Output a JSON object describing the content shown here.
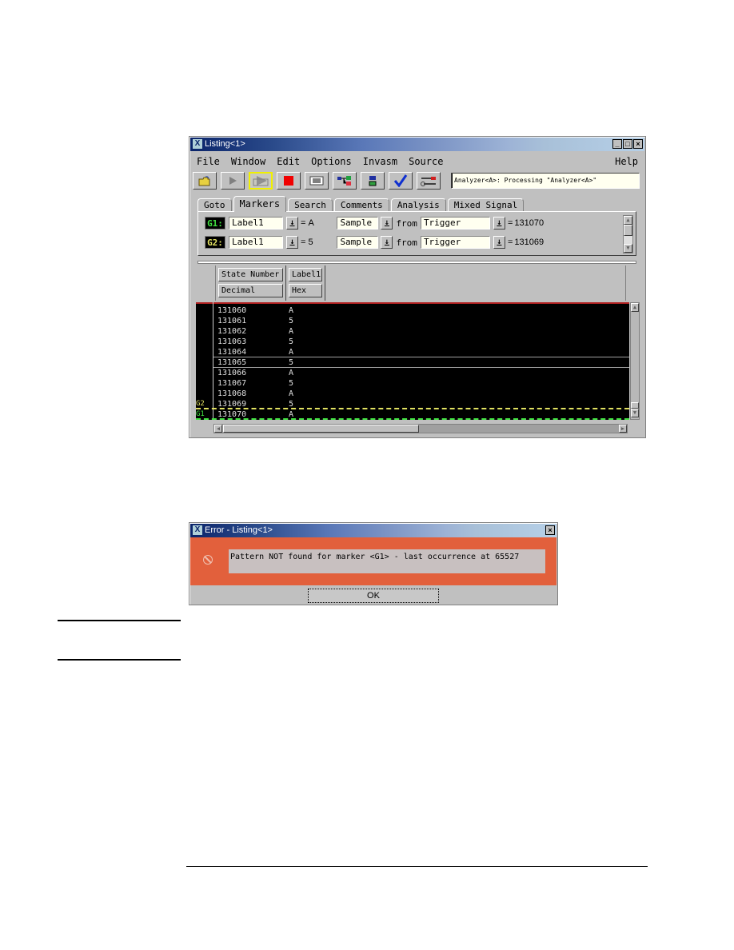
{
  "listing_window": {
    "title": "Listing<1>",
    "window_buttons": {
      "minimize": "_",
      "maximize": "□",
      "close": "×"
    },
    "menu": [
      "File",
      "Window",
      "Edit",
      "Options",
      "Invasm",
      "Source"
    ],
    "help_menu": "Help",
    "toolbar": [
      {
        "icon": "open-folder-icon",
        "active": false
      },
      {
        "icon": "run-icon",
        "active": false
      },
      {
        "icon": "run-repetitive-icon",
        "active": true
      },
      {
        "icon": "stop-icon",
        "active": false
      },
      {
        "icon": "listing-icon",
        "active": false
      },
      {
        "icon": "overview-icon",
        "active": false
      },
      {
        "icon": "module-icon",
        "active": false
      },
      {
        "icon": "checkmark-icon",
        "active": false
      },
      {
        "icon": "tools-icon",
        "active": false
      }
    ],
    "status_text": "Analyzer<A>: Processing \"Analyzer<A>\"",
    "tabs": [
      "Goto",
      "Markers",
      "Search",
      "Comments",
      "Analysis",
      "Mixed Signal"
    ],
    "active_tab": "Markers",
    "markers": [
      {
        "name": "G1:",
        "color": "#40e040",
        "label": "Label1",
        "value": "A",
        "mode": "Sample",
        "from_text": "from",
        "reference": "Trigger",
        "result": "131070"
      },
      {
        "name": "G2:",
        "color": "#e0e060",
        "label": "Label1",
        "value": "5",
        "mode": "Sample",
        "from_text": "from",
        "reference": "Trigger",
        "result": "131069"
      }
    ],
    "columns": [
      {
        "header": "State Number",
        "base": "Decimal"
      },
      {
        "header": "Label1",
        "base": "Hex"
      }
    ],
    "rows": [
      {
        "state": "131060",
        "value": "A"
      },
      {
        "state": "131061",
        "value": "5"
      },
      {
        "state": "131062",
        "value": "A"
      },
      {
        "state": "131063",
        "value": "5"
      },
      {
        "state": "131064",
        "value": "A"
      },
      {
        "state": "131065",
        "value": "5"
      },
      {
        "state": "131066",
        "value": "A"
      },
      {
        "state": "131067",
        "value": "5"
      },
      {
        "state": "131068",
        "value": "A"
      },
      {
        "state": "131069",
        "value": "5"
      },
      {
        "state": "131070",
        "value": "A"
      }
    ],
    "marker_gutter": {
      "g2": "G2",
      "g1": "G1"
    }
  },
  "error_dialog": {
    "title": "Error - Listing<1>",
    "message": "Pattern NOT found for marker <G1> - last occurrence at 65527",
    "ok_label": "OK",
    "close": "×"
  }
}
